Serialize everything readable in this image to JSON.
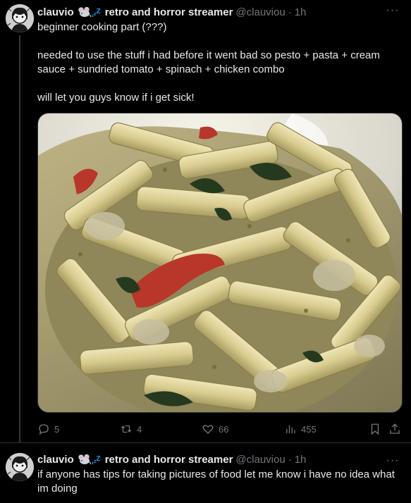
{
  "posts": [
    {
      "author": {
        "name": "clauvio",
        "badge_icon": "sleeping-mouse-emoji-icon",
        "display_suffix": "retro and horror streamer",
        "handle": "@clauviou"
      },
      "time": "1h",
      "more_label": "···",
      "text": "beginner cooking part (???)\n\nneeded to use the stuff i had before it went bad so pesto + pasta + cream sauce + sundried tomato + spinach + chicken combo\n\nwill let you guys know if i get sick!",
      "media": {
        "icon": "photo-of-pasta-with-pesto-cream-sauce"
      },
      "metrics": {
        "replies": "5",
        "reposts": "4",
        "likes": "66",
        "views": "455"
      }
    },
    {
      "author": {
        "name": "clauvio",
        "badge_icon": "sleeping-mouse-emoji-icon",
        "display_suffix": "retro and horror streamer",
        "handle": "@clauviou"
      },
      "time": "1h",
      "more_label": "···",
      "text": "if anyone has tips for taking pictures of food let me know i have no idea what im doing"
    }
  ],
  "colors": {
    "background": "#000000",
    "text_primary": "#e7e9ea",
    "text_secondary": "#71767b",
    "accent": "#1d9bf0"
  }
}
